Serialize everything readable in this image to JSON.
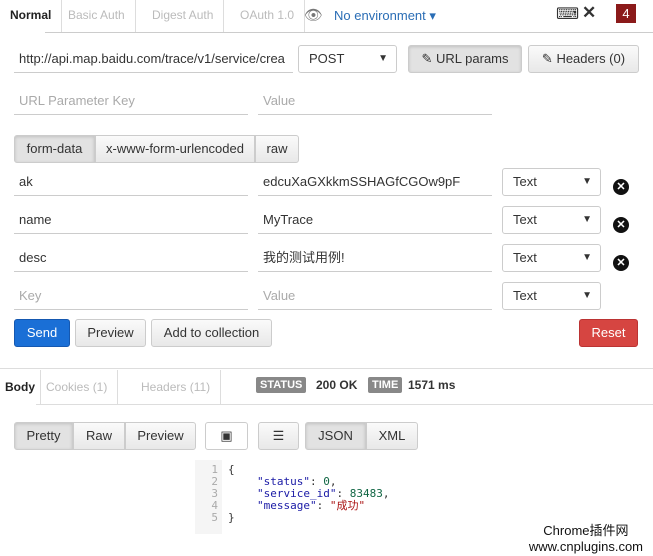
{
  "auth_tabs": [
    "Normal",
    "Basic Auth",
    "Digest Auth",
    "OAuth 1.0"
  ],
  "environment": "No environment",
  "notification_count": "4",
  "url": "http://api.map.baidu.com/trace/v1/service/crea",
  "method": "POST",
  "url_params_label": "URL params",
  "headers_label": "Headers (0)",
  "url_param_key_placeholder": "URL Parameter Key",
  "url_param_value_placeholder": "Value",
  "body_tabs": [
    "form-data",
    "x-www-form-urlencoded",
    "raw"
  ],
  "form_rows": [
    {
      "key": "ak",
      "value": "edcuXaGXkkmSSHAGfCGOw9pF",
      "type": "Text"
    },
    {
      "key": "name",
      "value": "MyTrace",
      "type": "Text"
    },
    {
      "key": "desc",
      "value": "我的测试用例!",
      "type": "Text"
    }
  ],
  "new_row": {
    "key_placeholder": "Key",
    "value_placeholder": "Value",
    "type": "Text"
  },
  "actions": {
    "send": "Send",
    "preview": "Preview",
    "add": "Add to collection",
    "reset": "Reset"
  },
  "response_tabs": [
    "Body",
    "Cookies (1)",
    "Headers (11)"
  ],
  "status_label": "STATUS",
  "status": "200 OK",
  "time_label": "TIME",
  "time": "1571 ms",
  "view_modes": [
    "Pretty",
    "Raw",
    "Preview"
  ],
  "formats": [
    "JSON",
    "XML"
  ],
  "code": {
    "lines": [
      "1",
      "2",
      "3",
      "4",
      "5"
    ],
    "status_key": "\"status\"",
    "status_val": "0",
    "sid_key": "\"service_id\"",
    "sid_val": "83483",
    "msg_key": "\"message\"",
    "msg_val": "\"成功\""
  },
  "watermark": [
    "Chrome插件网",
    "www.cnplugins.com"
  ],
  "colors": {
    "send": "#1a6fd6",
    "reset": "#d64541",
    "badge": "#8b1a1a",
    "link": "#2a6db5"
  }
}
